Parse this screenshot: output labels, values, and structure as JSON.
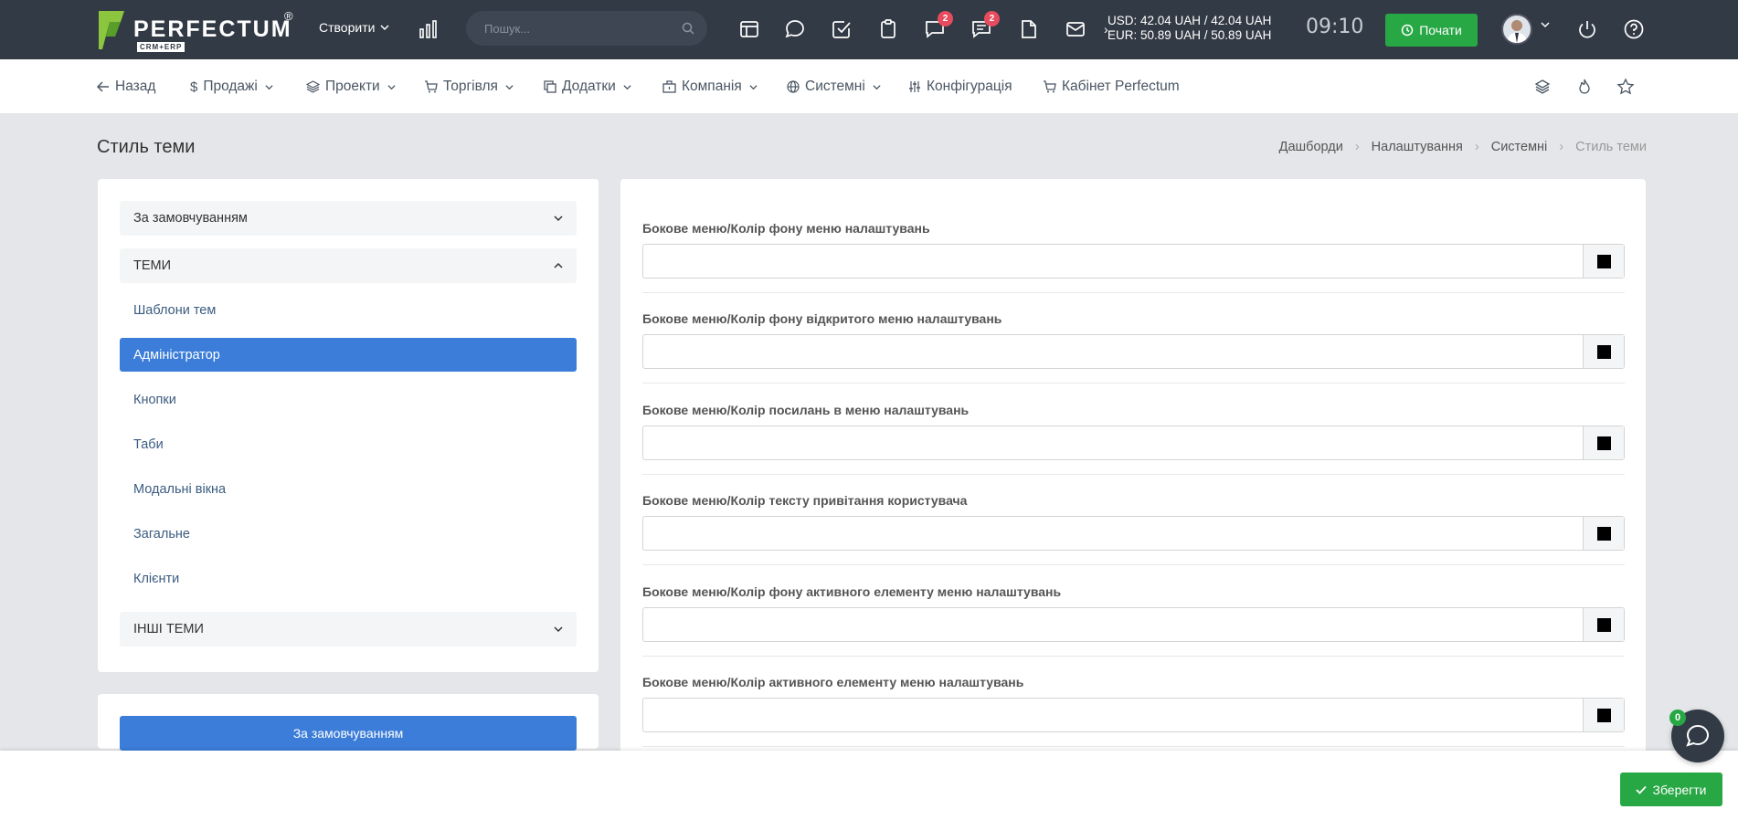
{
  "topbar": {
    "logo_name": "PERFECTUM",
    "logo_reg": "®",
    "logo_sub": "CRM+ERP",
    "create_label": "Створити",
    "search_placeholder": "Пошук...",
    "notif_badge_1": "2",
    "notif_badge_2": "2",
    "currency_usd": "USD: 42.04 UAH / 42.04 UAH",
    "currency_eur": "EUR: 50.89 UAH / 50.89 UAH",
    "clock": "09:10",
    "start_label": "Почати"
  },
  "nav": {
    "back": "Назад",
    "sales": "Продажі",
    "projects": "Проекти",
    "trade": "Торгівля",
    "addons": "Додатки",
    "company": "Компанія",
    "system": "Системні",
    "config": "Конфігурація",
    "cabinet": "Кабінет Perfectum"
  },
  "page": {
    "title": "Стиль теми",
    "breadcrumb": [
      "Дашборди",
      "Налаштування",
      "Системні",
      "Стиль теми"
    ]
  },
  "sidebar": {
    "default_dropdown": "За замовчуванням",
    "themes_header": "ТЕМИ",
    "items": [
      "Шаблони тем",
      "Адміністратор",
      "Кнопки",
      "Таби",
      "Модальні вікна",
      "Загальне",
      "Клієнти"
    ],
    "other_themes": "ІНШІ ТЕМИ",
    "default_button": "За замовчуванням"
  },
  "fields": [
    {
      "label": "Бокове меню/Колір фону меню налаштувань",
      "value": ""
    },
    {
      "label": "Бокове меню/Колір фону відкритого меню налаштувань",
      "value": ""
    },
    {
      "label": "Бокове меню/Колір посилань в меню налаштувань",
      "value": ""
    },
    {
      "label": "Бокове меню/Колір тексту привітання користувача",
      "value": ""
    },
    {
      "label": "Бокове меню/Колір фону активного елементу меню налаштувань",
      "value": ""
    },
    {
      "label": "Бокове меню/Колір активного елементу меню налаштувань",
      "value": ""
    }
  ],
  "footer": {
    "save_label": "Зберегти",
    "chat_badge": "0"
  },
  "colors": {
    "topbar": "#323a45",
    "accent_blue": "#3b7dd8",
    "accent_green": "#28a745",
    "badge_red": "#e74c5e"
  }
}
